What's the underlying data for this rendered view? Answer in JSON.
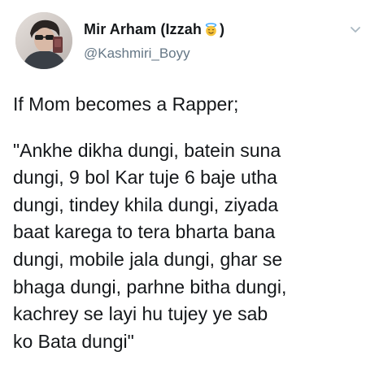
{
  "author": {
    "display_name": "Mir Arham (Izzah",
    "emoji_icon": "smiling-face-with-halo-icon",
    "name_close": ")",
    "handle": "@Kashmiri_Boyy"
  },
  "tweet": {
    "heading": "If Mom becomes a Rapper;",
    "quote_lines": [
      "\"Ankhe dikha dungi, batein suna",
      "dungi, 9 bol Kar tuje 6 baje utha",
      "dungi, tindey khila dungi, ziyada",
      "baat karega to tera bharta bana",
      "dungi, mobile jala dungi, ghar se",
      "bhaga dungi, parhne bitha dungi,",
      "kachrey se layi hu tujey ye sab",
      "ko Bata dungi\""
    ]
  },
  "colors": {
    "text": "#14171a",
    "secondary": "#657786",
    "caret": "#aab8c2"
  }
}
